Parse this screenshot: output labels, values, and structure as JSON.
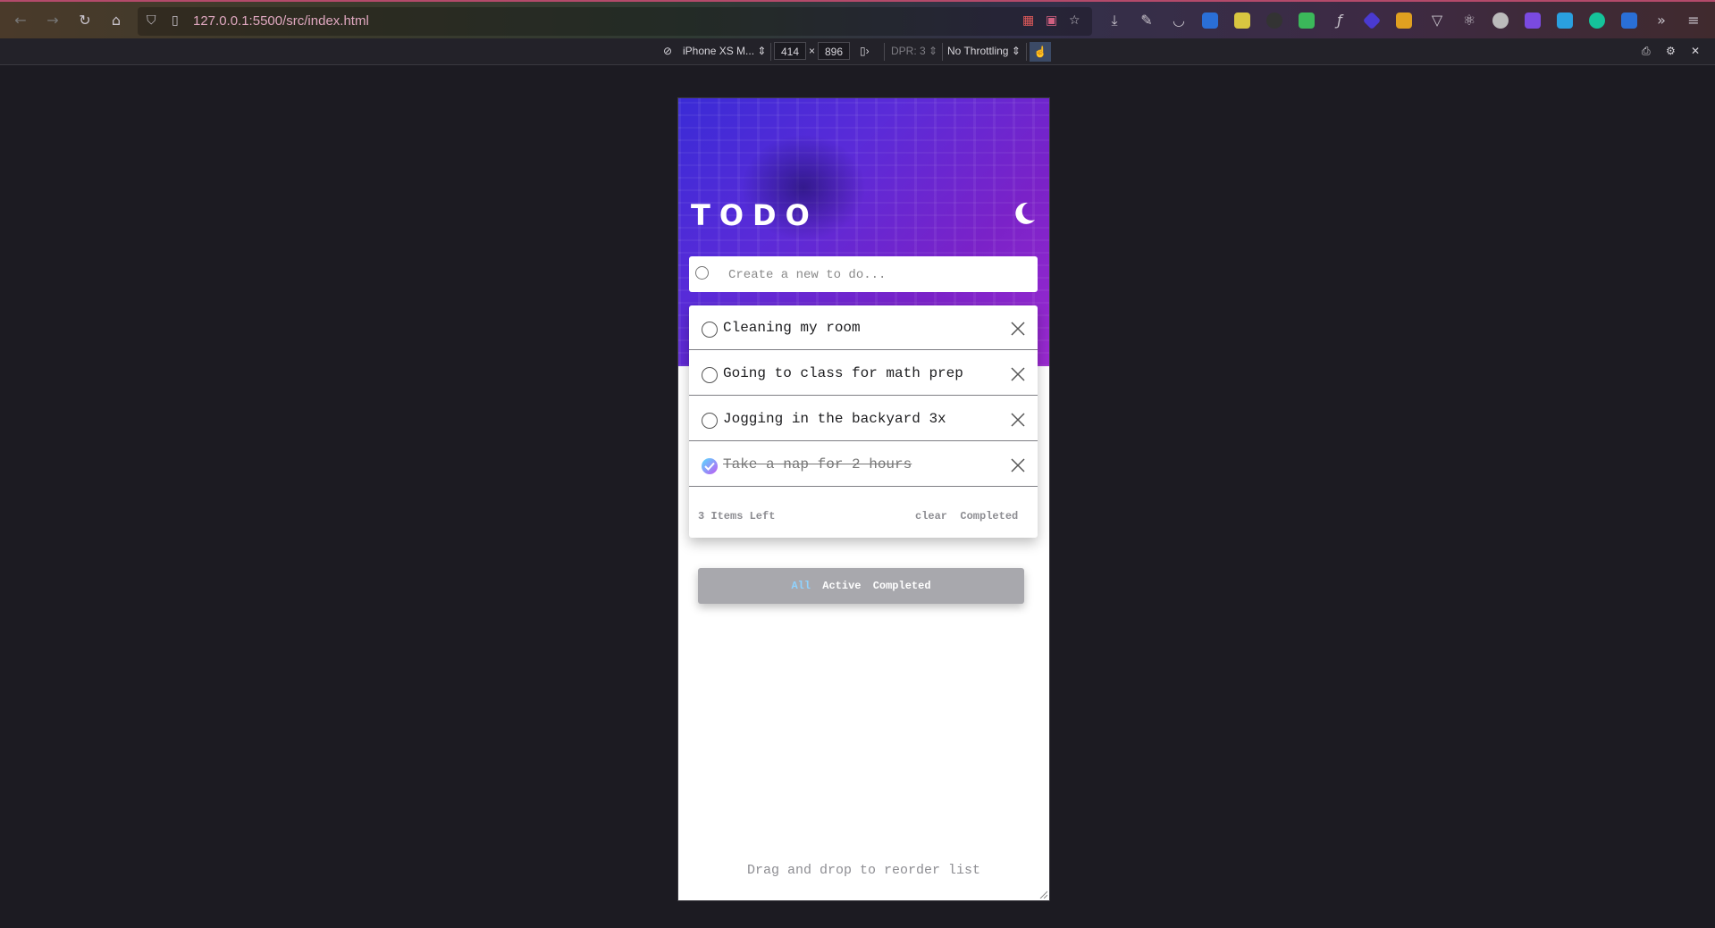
{
  "browser": {
    "url": "127.0.0.1:5500/src/index.html"
  },
  "rdm": {
    "device": "iPhone XS M...",
    "width": "414",
    "times": "×",
    "height": "896",
    "dpr": "DPR: 3",
    "throttling": "No Throttling"
  },
  "app": {
    "title": "TODO",
    "new_todo_placeholder": "Create a new to do...",
    "todos": [
      {
        "text": "Cleaning my room",
        "completed": false
      },
      {
        "text": "Going to class for math prep",
        "completed": false
      },
      {
        "text": "Jogging in the backyard 3x",
        "completed": false
      },
      {
        "text": "Take a nap for 2 hours",
        "completed": true
      }
    ],
    "items_left": "3 Items Left",
    "clear_completed": "clear  Completed",
    "filters": {
      "all": "All",
      "active": "Active",
      "completed": "Completed"
    },
    "hint": "Drag and drop to reorder list"
  },
  "colors": {
    "accent_gradient_start": "#57ddff",
    "accent_gradient_end": "#c058f3",
    "hero_start": "#3a2bd6",
    "hero_end": "#9a2ad0"
  }
}
